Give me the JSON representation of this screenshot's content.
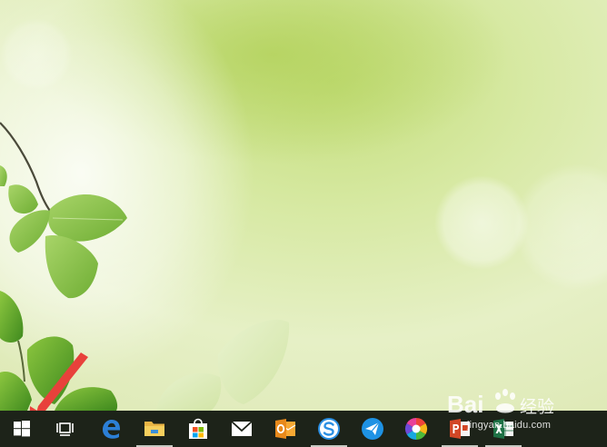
{
  "desktop": {
    "wallpaper": "green-leaves-bokeh"
  },
  "taskbar": {
    "background": "#1d2319",
    "buttons": [
      {
        "name": "start-button",
        "icon": "windows-logo-icon",
        "running": false
      },
      {
        "name": "task-view-button",
        "icon": "task-view-icon",
        "running": false
      },
      {
        "name": "edge-button",
        "icon": "edge-icon",
        "running": false
      },
      {
        "name": "file-explorer-button",
        "icon": "folder-icon",
        "running": true
      },
      {
        "name": "store-button",
        "icon": "store-bag-icon",
        "running": false
      },
      {
        "name": "mail-button",
        "icon": "mail-envelope-icon",
        "running": false
      },
      {
        "name": "outlook-button",
        "icon": "outlook-icon",
        "running": false
      },
      {
        "name": "sogou-browser-button",
        "icon": "sogou-s-icon",
        "running": true
      },
      {
        "name": "messenger-button",
        "icon": "paper-plane-icon",
        "running": false
      },
      {
        "name": "colorful-app-button",
        "icon": "pinwheel-icon",
        "running": false
      },
      {
        "name": "powerpoint-button",
        "icon": "powerpoint-icon",
        "running": true
      },
      {
        "name": "excel-button",
        "icon": "excel-icon",
        "running": true
      }
    ]
  },
  "annotation": {
    "arrow_color": "#e8413b",
    "points_to": "start-button"
  },
  "watermark": {
    "brand": "Bai",
    "brand_suffix": "经验",
    "subtitle": "jingyan.baidu.com"
  }
}
